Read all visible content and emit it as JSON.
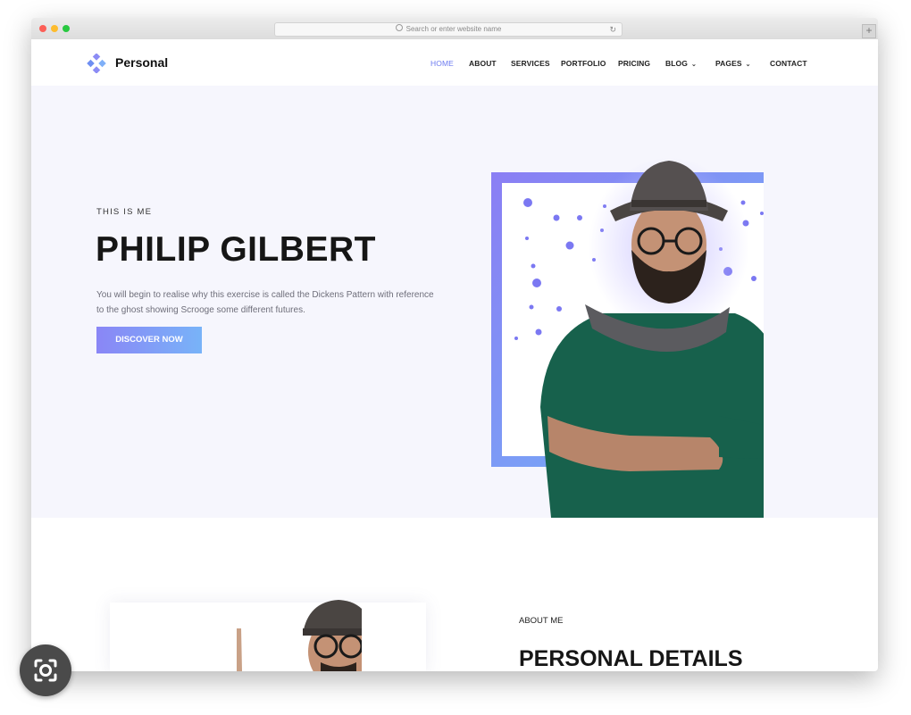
{
  "browser": {
    "url_placeholder": "Search or enter website name",
    "new_tab_symbol": "+",
    "reload_symbol": "↻"
  },
  "site": {
    "brand": "Personal",
    "accent_color": "#6d7bf0",
    "nav": [
      {
        "label": "HOME",
        "active": true
      },
      {
        "label": "ABOUT"
      },
      {
        "label": "SERVICES"
      },
      {
        "label": "PORTFOLIO"
      },
      {
        "label": "PRICING"
      },
      {
        "label": "BLOG",
        "dropdown": true
      },
      {
        "label": "PAGES",
        "dropdown": true
      },
      {
        "label": "CONTACT"
      }
    ],
    "dropdown_symbol": "⌄"
  },
  "hero": {
    "eyebrow": "THIS IS ME",
    "title": "PHILIP GILBERT",
    "description": "You will begin to realise why this exercise is called the Dickens Pattern with reference to the ghost showing Scrooge some different futures.",
    "cta_label": "DISCOVER NOW"
  },
  "about": {
    "eyebrow": "ABOUT ME",
    "title": "PERSONAL DETAILS"
  }
}
